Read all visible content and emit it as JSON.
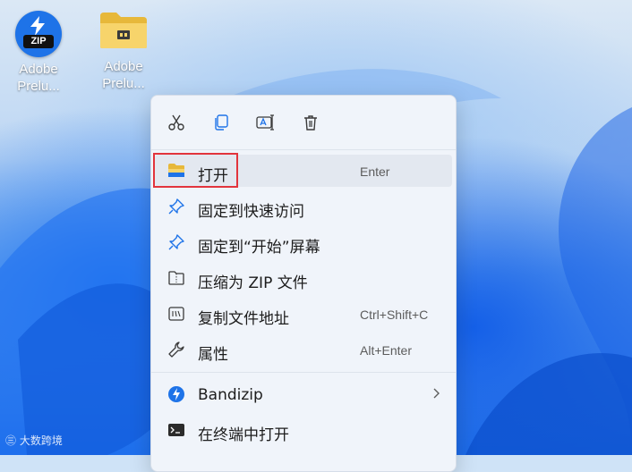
{
  "desktop": {
    "icons": [
      {
        "name": "zip-archive",
        "label_line1": "Adobe",
        "label_line2": "Prelu...",
        "badge_text": "ZIP"
      },
      {
        "name": "folder",
        "label_line1": "Adobe",
        "label_line2": "Prelu..."
      }
    ]
  },
  "context_menu": {
    "toolbar": [
      {
        "icon": "cut-icon"
      },
      {
        "icon": "copy-icon"
      },
      {
        "icon": "rename-icon"
      },
      {
        "icon": "delete-icon"
      }
    ],
    "items": [
      {
        "icon": "folder-open-icon",
        "label": "打开",
        "shortcut": "Enter"
      },
      {
        "icon": "pin-icon",
        "label": "固定到快速访问",
        "shortcut": ""
      },
      {
        "icon": "pin-icon",
        "label": "固定到“开始”屏幕",
        "shortcut": ""
      },
      {
        "icon": "zip-folder-icon",
        "label": "压缩为 ZIP 文件",
        "shortcut": ""
      },
      {
        "icon": "copy-path-icon",
        "label": "复制文件地址",
        "shortcut": "Ctrl+Shift+C"
      },
      {
        "icon": "wrench-icon",
        "label": "属性",
        "shortcut": "Alt+Enter"
      },
      {
        "icon": "bandizip-icon",
        "label": "Bandizip",
        "shortcut": "",
        "has_submenu": true
      },
      {
        "icon": "terminal-icon",
        "label": "在终端中打开",
        "shortcut": ""
      }
    ]
  },
  "watermark": "大数跨境",
  "colors": {
    "highlight_box": "#e2343c",
    "menu_bg": "#f0f4fa",
    "accent": "#1e73e8"
  }
}
